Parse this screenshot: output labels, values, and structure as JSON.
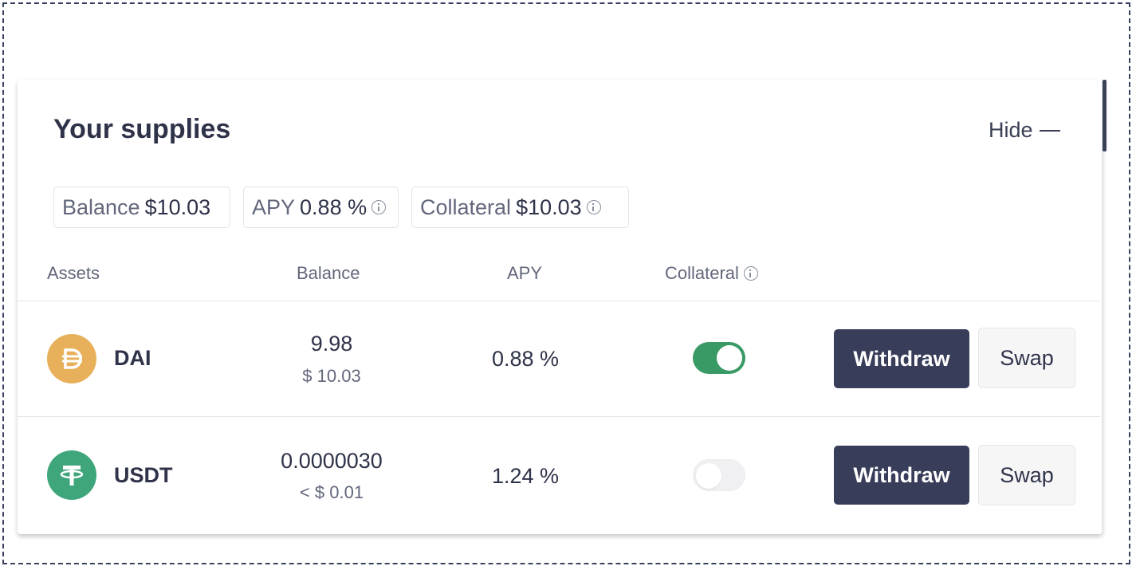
{
  "header": {
    "title": "Your supplies",
    "hide_label": "Hide"
  },
  "summary": {
    "balance_label": "Balance",
    "balance_value": "$10.03",
    "apy_label": "APY",
    "apy_value": "0.88 %",
    "collateral_label": "Collateral",
    "collateral_value": "$10.03"
  },
  "columns": {
    "assets": "Assets",
    "balance": "Balance",
    "apy": "APY",
    "collateral": "Collateral"
  },
  "rows": [
    {
      "symbol": "DAI",
      "balance": "9.98",
      "balance_usd": "$ 10.03",
      "apy": "0.88 %",
      "collateral_enabled": true,
      "icon": "dai-icon",
      "icon_color": "#e8b05a",
      "withdraw_label": "Withdraw",
      "swap_label": "Swap"
    },
    {
      "symbol": "USDT",
      "balance": "0.0000030",
      "balance_usd": "< $ 0.01",
      "apy": "1.24 %",
      "collateral_enabled": false,
      "icon": "usdt-icon",
      "icon_color": "#3ea67a",
      "withdraw_label": "Withdraw",
      "swap_label": "Swap"
    }
  ],
  "colors": {
    "primary_button": "#383d59",
    "toggle_on": "#3a9a65"
  }
}
